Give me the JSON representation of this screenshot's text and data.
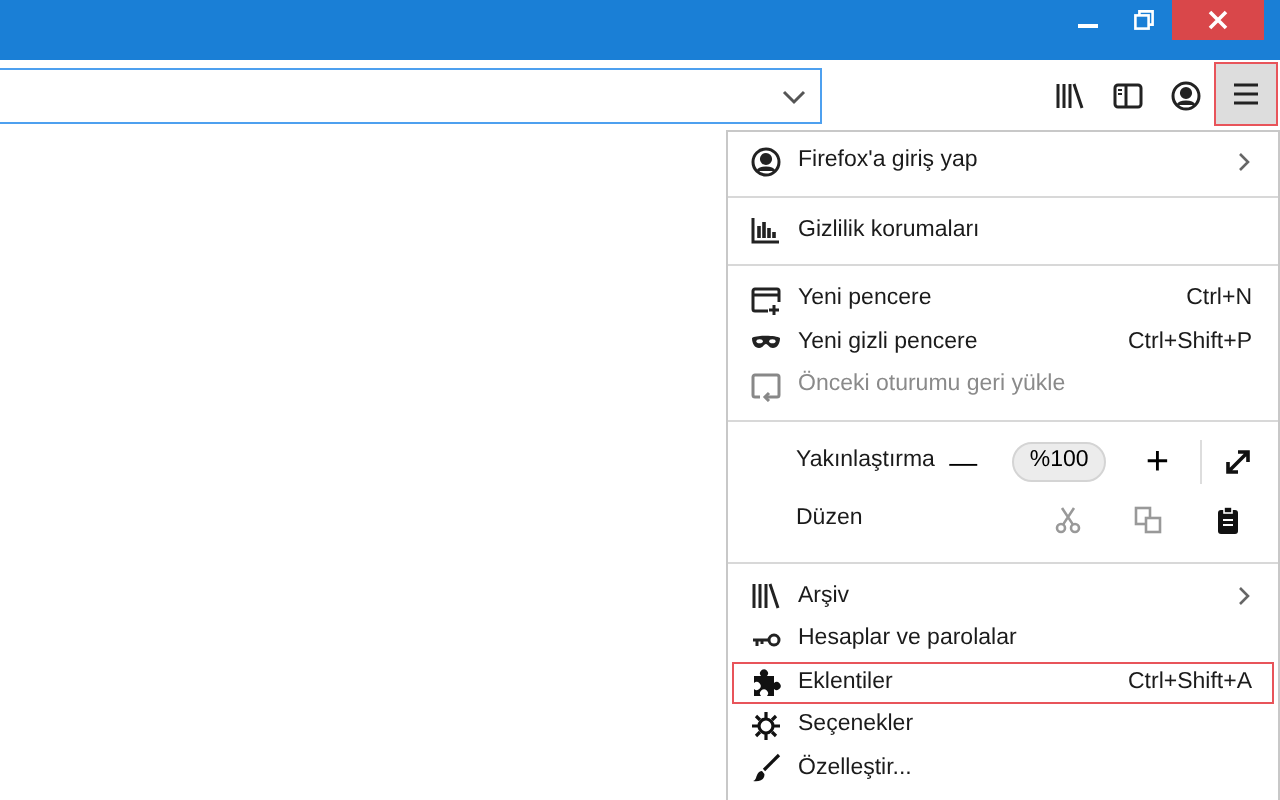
{
  "window": {
    "controls": [
      {
        "kind": "minimize"
      },
      {
        "kind": "maximize"
      },
      {
        "kind": "close"
      }
    ]
  },
  "toolbar": {
    "buttons": [
      {
        "kind": "library",
        "highlighted": false
      },
      {
        "kind": "sidebar",
        "highlighted": false
      },
      {
        "kind": "account",
        "highlighted": false
      },
      {
        "kind": "menu",
        "highlighted": true
      }
    ]
  },
  "menu": {
    "items": [
      {
        "kind": "item",
        "label": "Firefox'a giriş yap",
        "submenu": true,
        "disabled": false,
        "highlighted": false
      },
      {
        "kind": "separator"
      },
      {
        "kind": "item",
        "label": "Gizlilik korumaları",
        "submenu": false,
        "disabled": false,
        "highlighted": false
      },
      {
        "kind": "separator"
      },
      {
        "kind": "item",
        "label": "Yeni pencere",
        "shortcut": "Ctrl+N",
        "submenu": false,
        "disabled": false,
        "highlighted": false
      },
      {
        "kind": "item",
        "label": "Yeni gizli pencere",
        "shortcut": "Ctrl+Shift+P",
        "submenu": false,
        "disabled": false,
        "highlighted": false
      },
      {
        "kind": "item",
        "label": "Önceki oturumu geri yükle",
        "submenu": false,
        "disabled": true,
        "highlighted": false
      },
      {
        "kind": "separator"
      },
      {
        "kind": "zoom",
        "label": "Yakınlaştırma",
        "minus": "—",
        "value": "%100",
        "plus": "+"
      },
      {
        "kind": "edit",
        "label": "Düzen"
      },
      {
        "kind": "separator"
      },
      {
        "kind": "item",
        "label": "Arşiv",
        "submenu": true,
        "disabled": false,
        "highlighted": false
      },
      {
        "kind": "item",
        "label": "Hesaplar ve parolalar",
        "submenu": false,
        "disabled": false,
        "highlighted": false
      },
      {
        "kind": "item",
        "label": "Eklentiler",
        "shortcut": "Ctrl+Shift+A",
        "submenu": false,
        "disabled": false,
        "highlighted": true
      },
      {
        "kind": "item",
        "label": "Seçenekler",
        "submenu": false,
        "disabled": false,
        "highlighted": false
      },
      {
        "kind": "item",
        "label": "Özelleştir...",
        "submenu": false,
        "disabled": false,
        "highlighted": false
      }
    ]
  }
}
